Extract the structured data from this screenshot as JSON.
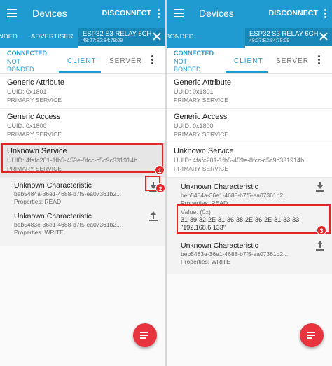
{
  "colors": {
    "primary": "#1f9bd1",
    "primary_dark": "#1886b6",
    "fab": "#e8343f",
    "annotation": "#e32626"
  },
  "panels": [
    {
      "appbar": {
        "title": "Devices",
        "action": "DISCONNECT"
      },
      "devtabs": {
        "prev_tab": "NDED",
        "advertiser": "ADVERTISER",
        "device_name": "ESP32 S3 RELAY 6CH",
        "device_mac": "48:27:E2:84:79:09"
      },
      "status": {
        "connection": "CONNECTED",
        "bond": "NOT BONDED",
        "tab_client": "CLIENT",
        "tab_server": "SERVER"
      },
      "services": [
        {
          "name": "Generic Attribute",
          "uuid": "UUID: 0x1801",
          "type": "PRIMARY SERVICE"
        },
        {
          "name": "Generic Access",
          "uuid": "UUID: 0x1800",
          "type": "PRIMARY SERVICE"
        },
        {
          "name": "Unknown Service",
          "uuid": "UUID: 4fafc201-1fb5-459e-8fcc-c5c9c331914b",
          "type": "PRIMARY SERVICE"
        }
      ],
      "characteristics": [
        {
          "name": "Unknown Characteristic",
          "uuid": "beb5484a-36e1-4688-b7f5-ea07361b2...",
          "props": "Properties: READ"
        },
        {
          "name": "Unknown Characteristic",
          "uuid": "beb5483e-36e1-4688-b7f5-ea07361b2...",
          "props": "Properties: WRITE"
        }
      ],
      "markers": [
        "1",
        "2"
      ]
    },
    {
      "appbar": {
        "title": "Devices",
        "action": "DISCONNECT"
      },
      "devtabs": {
        "prev_tab": "BONDED",
        "advertiser": "",
        "device_name": "ESP32 S3 RELAY 6CH",
        "device_mac": "48:27:E2:84:79:09"
      },
      "status": {
        "connection": "CONNECTED",
        "bond": "NOT BONDED",
        "tab_client": "CLIENT",
        "tab_server": "SERVER"
      },
      "services": [
        {
          "name": "Generic Attribute",
          "uuid": "UUID: 0x1801",
          "type": "PRIMARY SERVICE"
        },
        {
          "name": "Generic Access",
          "uuid": "UUID: 0x1800",
          "type": "PRIMARY SERVICE"
        },
        {
          "name": "Unknown Service",
          "uuid": "UUID: 4fafc201-1fb5-459e-8fcc-c5c9c331914b",
          "type": "PRIMARY SERVICE"
        }
      ],
      "characteristics": [
        {
          "name": "Unknown Characteristic",
          "uuid": "beb5484a-36e1-4688-b7f5-ea07361b2...",
          "props": "Properties: READ",
          "value_label": "Value: (0x)",
          "value_hex": "31-39-32-2E-31-36-38-2E-36-2E-31-33-33,",
          "value_text": "\"192.168.6.133\""
        },
        {
          "name": "Unknown Characteristic",
          "uuid": "beb5483e-36e1-4688-b7f5-ea07361b2...",
          "props": "Properties: WRITE"
        }
      ],
      "markers": [
        "3"
      ]
    }
  ],
  "icons": {
    "menu": "hamburger-menu-icon",
    "more": "more-vert-icon",
    "close": "close-icon",
    "read": "download-read-icon",
    "write": "upload-write-icon",
    "fab": "list-filter-icon"
  }
}
